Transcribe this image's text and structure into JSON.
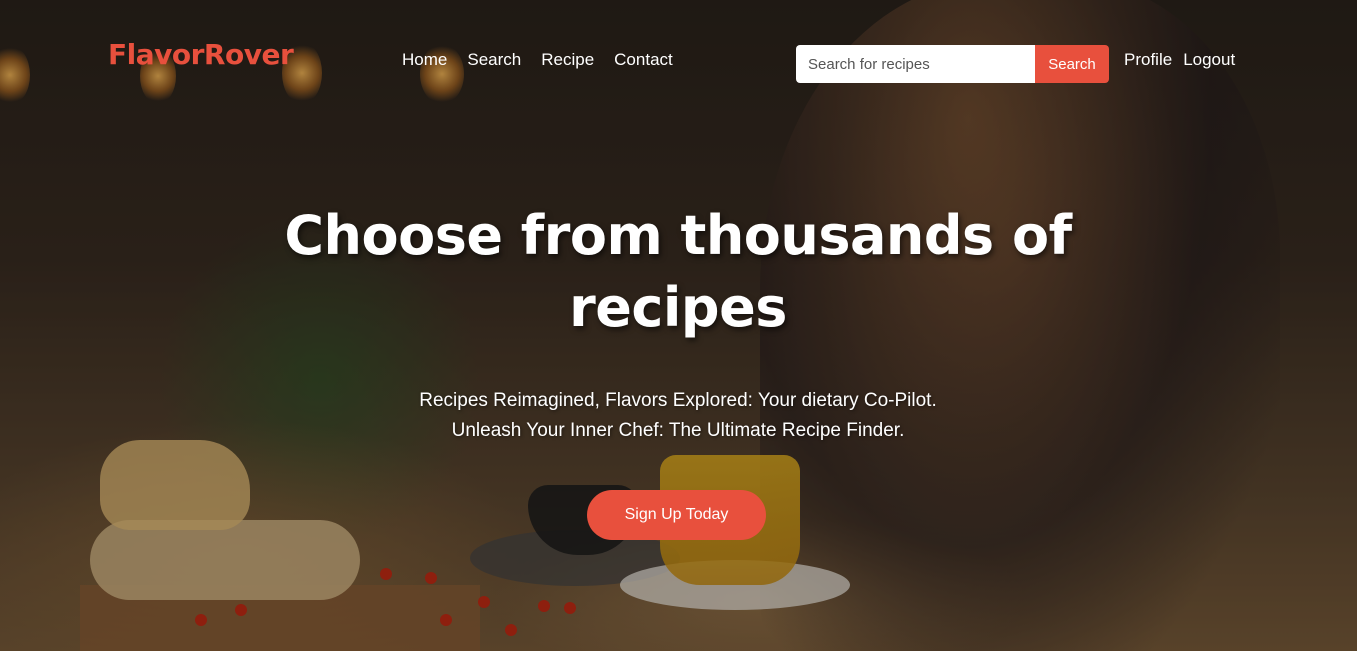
{
  "brand": {
    "name": "FlavorRover"
  },
  "nav": {
    "links": [
      "Home",
      "Search",
      "Recipe",
      "Contact"
    ]
  },
  "search": {
    "placeholder": "Search for recipes",
    "value": "",
    "button_label": "Search"
  },
  "user_links": [
    "Profile",
    "Logout"
  ],
  "hero": {
    "title_line1": "Choose from thousands of",
    "title_line2": "recipes",
    "subtitle_line1": "Recipes Reimagined, Flavors Explored: Your dietary Co-Pilot.",
    "subtitle_line2": "Unleash Your Inner Chef: The Ultimate Recipe Finder.",
    "cta_label": "Sign Up Today"
  },
  "colors": {
    "accent": "#e8503d",
    "text": "#ffffff"
  }
}
